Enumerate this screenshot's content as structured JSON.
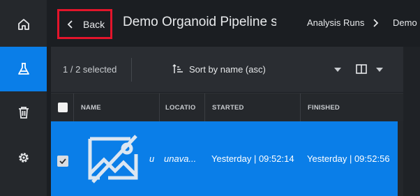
{
  "rail": {
    "items": [
      {
        "icon": "home-icon"
      },
      {
        "icon": "flask-icon",
        "active": true
      },
      {
        "icon": "trash-icon"
      },
      {
        "icon": "gear-icon"
      }
    ]
  },
  "header": {
    "back_label": "Back",
    "title": "Demo Organoid Pipeline si...",
    "breadcrumb": [
      "Analysis Runs",
      "Demo"
    ]
  },
  "toolbar": {
    "selection": "1 / 2 selected",
    "sort_label": "Sort by name (asc)"
  },
  "table": {
    "columns": [
      "NAME",
      "LOCATIO",
      "STARTED",
      "FINISHED"
    ],
    "rows": [
      {
        "thumbnail": "image-unavailable-icon",
        "name": "u",
        "location": "unava...",
        "started": "Yesterday | 09:52:14",
        "finished": "Yesterday | 09:52:56",
        "selected": true
      }
    ]
  },
  "colors": {
    "accent": "#0a7ee8",
    "highlight_border": "#e3152b",
    "background": "#1b1e22"
  }
}
